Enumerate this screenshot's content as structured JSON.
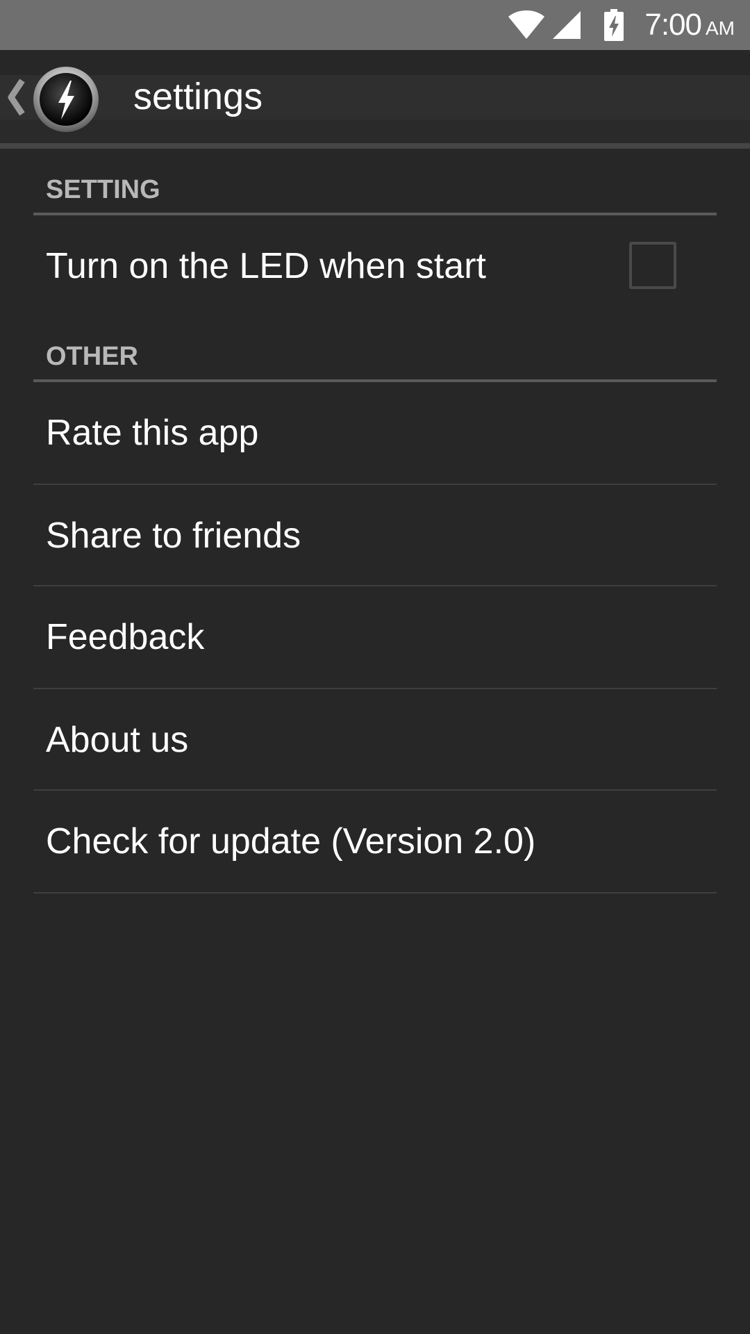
{
  "status_bar": {
    "time": "7:00",
    "ampm": "AM",
    "icons": [
      "wifi-icon",
      "signal-icon",
      "battery-charging-icon"
    ]
  },
  "action_bar": {
    "title": "settings",
    "up_icon": "back-chevron-icon",
    "logo_icon": "flashlight-bolt-logo-icon"
  },
  "categories": [
    {
      "title": "SETTING",
      "items": [
        {
          "label": "Turn on the LED when start",
          "checkbox": true,
          "checked": false
        }
      ]
    },
    {
      "title": "OTHER",
      "items": [
        {
          "label": "Rate this app"
        },
        {
          "label": "Share to friends"
        },
        {
          "label": "Feedback"
        },
        {
          "label": "About us"
        },
        {
          "label": "Check for update (Version 2.0)"
        }
      ]
    }
  ],
  "colors": {
    "background": "#272727",
    "status_bar": "#6f6f6f",
    "category_text": "#b8b8b8",
    "divider": "#3f3f3f"
  }
}
